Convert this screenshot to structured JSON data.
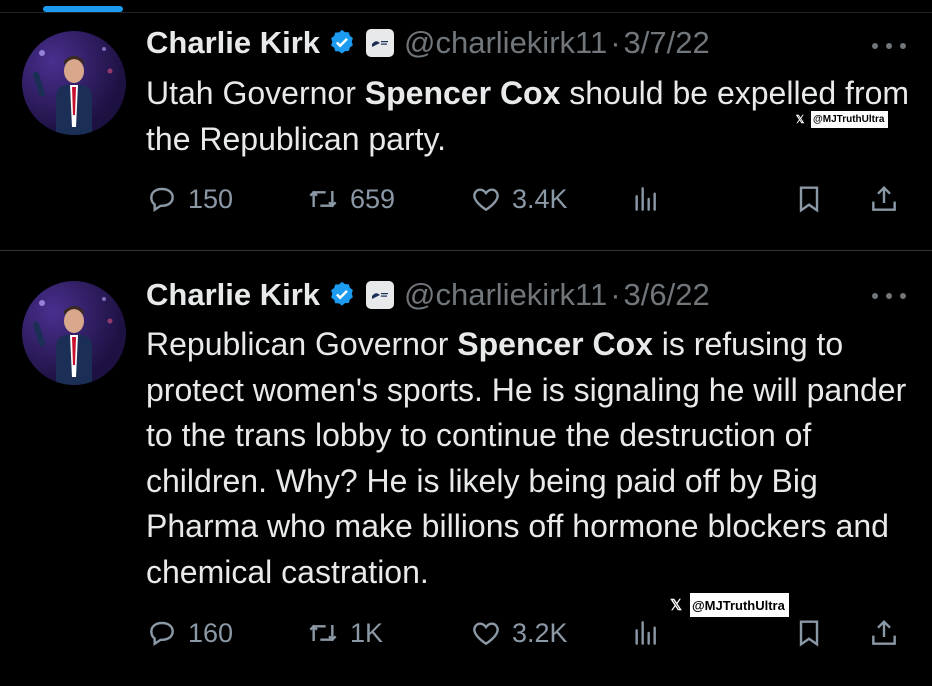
{
  "watermark": {
    "x_glyph": "𝕏",
    "text": "@MJTruthUltra"
  },
  "tweets": [
    {
      "author": {
        "name": "Charlie Kirk",
        "handle": "@charliekirk11",
        "verified": true,
        "verified_icon": "verified-badge-icon",
        "affiliation_icon": "affiliation-badge-icon"
      },
      "separator": "·",
      "date": "3/7/22",
      "text_parts": {
        "t0": "Utah Governor ",
        "b0": "Spencer Cox",
        "t1": " should be expelled from the Republican party."
      },
      "stats": {
        "replies": "150",
        "retweets": "659",
        "likes": "3.4K"
      }
    },
    {
      "author": {
        "name": "Charlie Kirk",
        "handle": "@charliekirk11",
        "verified": true,
        "verified_icon": "verified-badge-icon",
        "affiliation_icon": "affiliation-badge-icon"
      },
      "separator": "·",
      "date": "3/6/22",
      "text_parts": {
        "t0": "Republican Governor ",
        "b0": "Spencer Cox",
        "t1": " is refusing to protect women's sports. He is signaling he will pander to the trans lobby to continue the destruction of children. Why? He is likely being paid off by Big Pharma who make billions off hormone blockers and chemical castration."
      },
      "stats": {
        "replies": "160",
        "retweets": "1K",
        "likes": "3.2K"
      }
    }
  ],
  "icons": [
    "reply-icon",
    "retweet-icon",
    "like-icon",
    "views-icon",
    "bookmark-icon",
    "share-icon",
    "more-icon"
  ],
  "colors": {
    "background": "#000000",
    "text": "#e7e9ea",
    "muted": "#71767b",
    "accent": "#1d9bf0",
    "divider": "#2f3336"
  }
}
